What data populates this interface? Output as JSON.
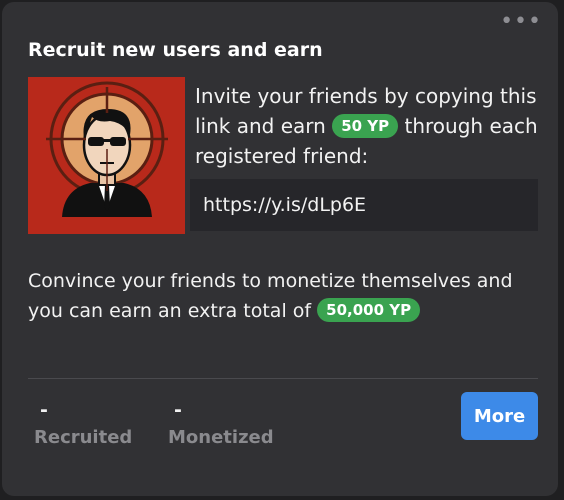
{
  "card": {
    "title": "Recruit new users and earn",
    "menu_icon": "more-dots-icon",
    "avatar_icon": "agent-in-crosshair-illustration",
    "invite_text_before": "Invite your friends by copying this link and earn",
    "invite_reward": "50 YP",
    "invite_text_after": "through each registered friend:",
    "referral_link": "https://y.is/dLp6E",
    "convince_text": "Convince your friends to monetize themselves and you can earn an extra total of",
    "convince_reward": "50,000 YP",
    "stats": [
      {
        "value": "-",
        "label": "Recruited"
      },
      {
        "value": "-",
        "label": "Monetized"
      }
    ],
    "more_label": "More"
  },
  "colors": {
    "card_background": "#313134",
    "reward_pill": "#3aa350",
    "button_accent": "#3d8ae8",
    "avatar_background": "#b8291b"
  }
}
